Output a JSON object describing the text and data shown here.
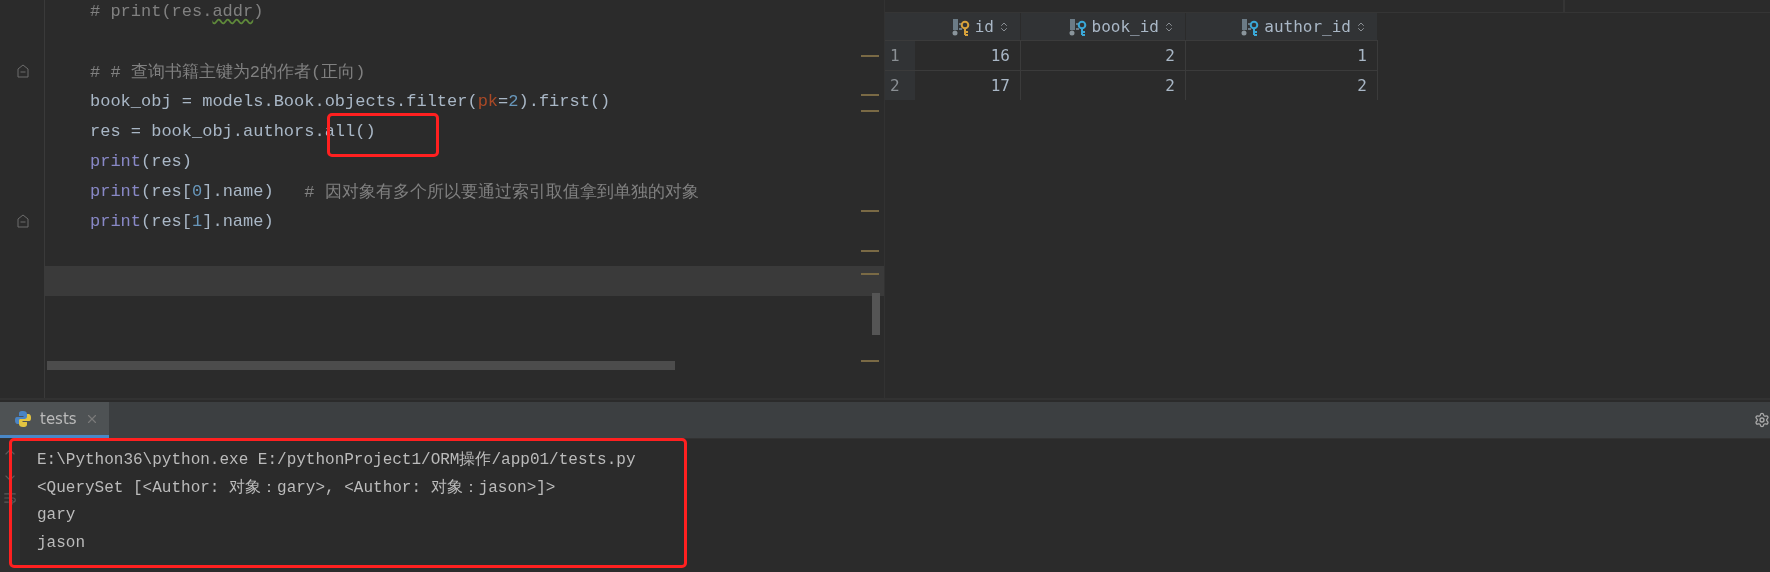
{
  "editor": {
    "lines": [
      {
        "kind": "code",
        "fold_marker": false,
        "tokens": [
          {
            "kind": "comment",
            "text": "# print(res."
          },
          {
            "kind": "comment_warning",
            "text": "addr"
          },
          {
            "kind": "comment",
            "text": ")"
          }
        ]
      },
      {
        "kind": "blank",
        "fold_marker": false
      },
      {
        "kind": "code",
        "fold_marker": true,
        "tokens": [
          {
            "kind": "comment",
            "text": "# # 查询书籍主键为2的作者(正向)"
          }
        ]
      },
      {
        "kind": "code",
        "fold_marker": false,
        "tokens": [
          {
            "kind": "plain",
            "text": "book_obj = models.Book.objects.filter("
          },
          {
            "kind": "param",
            "text": "pk"
          },
          {
            "kind": "plain",
            "text": "="
          },
          {
            "kind": "number",
            "text": "2"
          },
          {
            "kind": "plain",
            "text": ").first()"
          }
        ]
      },
      {
        "kind": "code",
        "fold_marker": false,
        "tokens": [
          {
            "kind": "plain",
            "text": "res = book_obj.authors.all()"
          }
        ]
      },
      {
        "kind": "code",
        "fold_marker": false,
        "tokens": [
          {
            "kind": "builtin",
            "text": "print"
          },
          {
            "kind": "plain",
            "text": "(res)"
          }
        ]
      },
      {
        "kind": "code",
        "fold_marker": false,
        "tokens": [
          {
            "kind": "builtin",
            "text": "print"
          },
          {
            "kind": "plain",
            "text": "(res["
          },
          {
            "kind": "number",
            "text": "0"
          },
          {
            "kind": "plain",
            "text": "].name)   "
          },
          {
            "kind": "comment",
            "text": "# 因对象有多个所以要通过索引取值拿到单独的对象"
          }
        ]
      },
      {
        "kind": "code",
        "fold_marker": true,
        "tokens": [
          {
            "kind": "builtin",
            "text": "print"
          },
          {
            "kind": "plain",
            "text": "(res["
          },
          {
            "kind": "number",
            "text": "1"
          },
          {
            "kind": "plain",
            "text": "].name)"
          }
        ]
      },
      {
        "kind": "blank",
        "fold_marker": false
      },
      {
        "kind": "caret_line",
        "fold_marker": false
      }
    ]
  },
  "table": {
    "columns": [
      {
        "label": "id",
        "kind": "primary_key"
      },
      {
        "label": "book_id",
        "kind": "foreign_key"
      },
      {
        "label": "author_id",
        "kind": "foreign_key"
      }
    ],
    "rows": [
      {
        "number": "1",
        "cells": [
          "16",
          "2",
          "1"
        ]
      },
      {
        "number": "2",
        "cells": [
          "17",
          "2",
          "2"
        ]
      }
    ]
  },
  "run_panel": {
    "tabs": [
      {
        "label": "tests",
        "selected": true
      }
    ],
    "output": [
      "E:\\Python36\\python.exe E:/pythonProject1/ORM操作/app01/tests.py",
      "<QuerySet [<Author: 对象：gary>, <Author: 对象：jason>]>",
      "gary",
      "jason"
    ]
  }
}
